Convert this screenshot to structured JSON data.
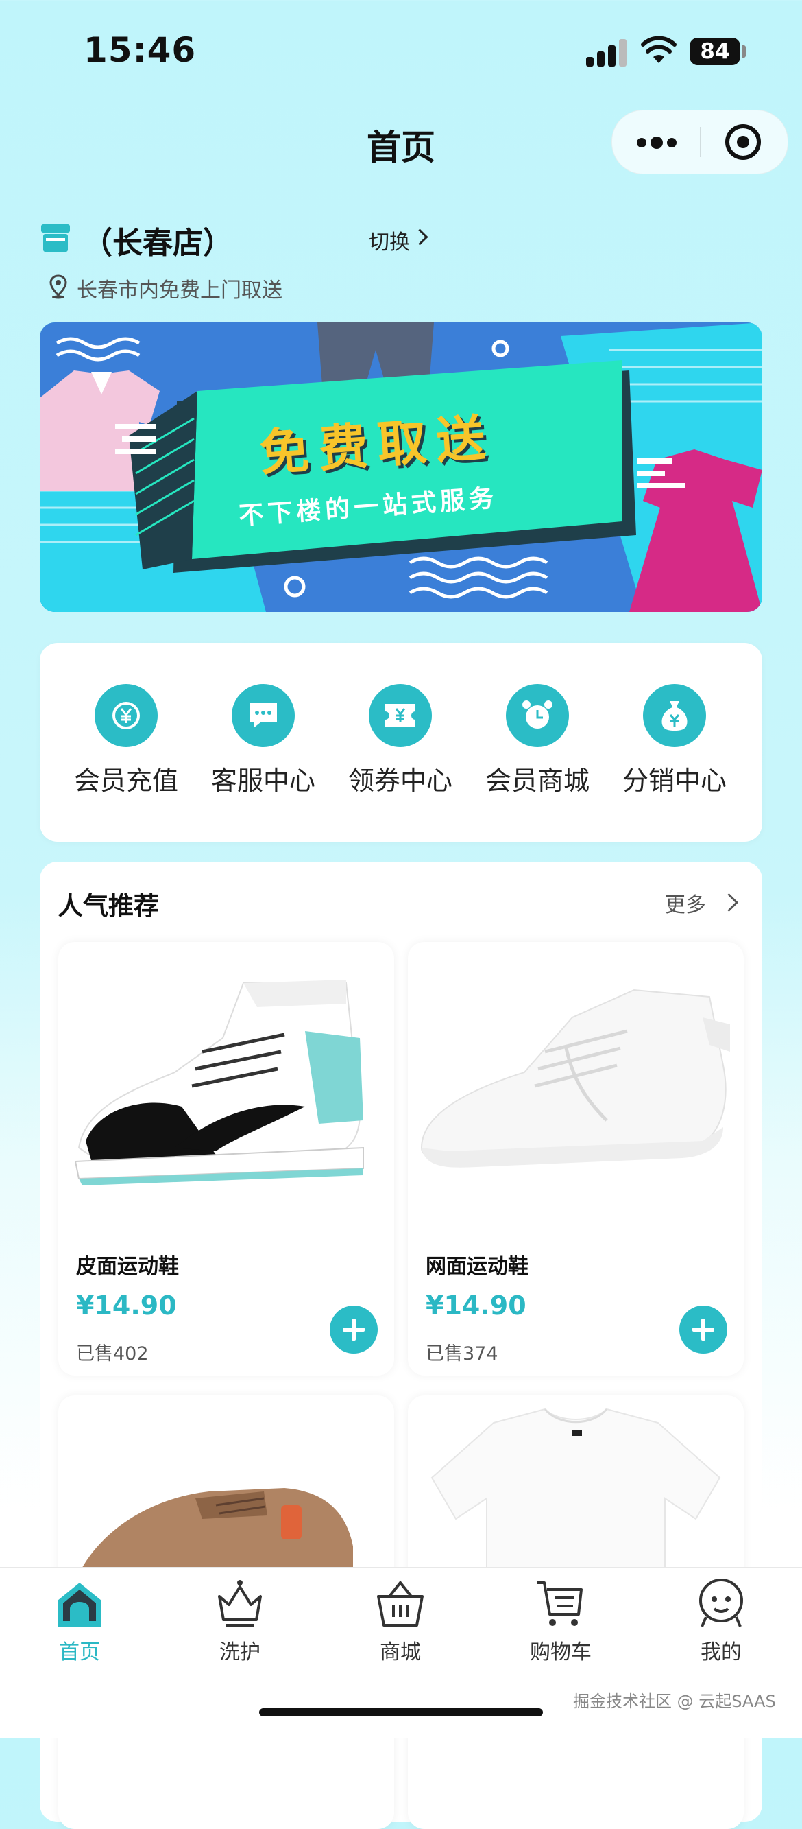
{
  "status": {
    "time": "15:46",
    "battery": "84"
  },
  "nav": {
    "title": "首页"
  },
  "store": {
    "name": "（长春店）",
    "switch_label": "切换",
    "description": "长春市内免费上门取送"
  },
  "banner": {
    "headline": "免费取送",
    "subtitle": "不下楼的一站式服务"
  },
  "quick_menu": [
    {
      "label": "会员充值",
      "icon": "yuan-icon"
    },
    {
      "label": "客服中心",
      "icon": "chat-icon"
    },
    {
      "label": "领券中心",
      "icon": "coupon-icon"
    },
    {
      "label": "会员商城",
      "icon": "alarm-clock-icon"
    },
    {
      "label": "分销中心",
      "icon": "money-bag-icon"
    }
  ],
  "recommend": {
    "title": "人气推荐",
    "more_label": "更多",
    "products": [
      {
        "name": "皮面运动鞋",
        "price": "¥14.90",
        "sold": "已售402",
        "image": "sneaker-teal-black-image"
      },
      {
        "name": "网面运动鞋",
        "price": "¥14.90",
        "sold": "已售374",
        "image": "sneaker-white-knit-image"
      },
      {
        "name": "",
        "price": "",
        "sold": "",
        "image": "suede-shoe-image"
      },
      {
        "name": "",
        "price": "",
        "sold": "",
        "image": "white-tshirt-image"
      }
    ]
  },
  "tabbar": [
    {
      "label": "首页",
      "icon": "home-icon",
      "active": true
    },
    {
      "label": "洗护",
      "icon": "crown-icon",
      "active": false
    },
    {
      "label": "商城",
      "icon": "basket-icon",
      "active": false
    },
    {
      "label": "购物车",
      "icon": "cart-icon",
      "active": false
    },
    {
      "label": "我的",
      "icon": "profile-icon",
      "active": false
    }
  ],
  "watermark": "掘金技术社区 @ 云起SAAS",
  "colors": {
    "accent": "#2bbcc6",
    "banner_bg": "#2fd6ee",
    "banner_panel": "#26e6c0",
    "headline": "#f7c52a"
  }
}
